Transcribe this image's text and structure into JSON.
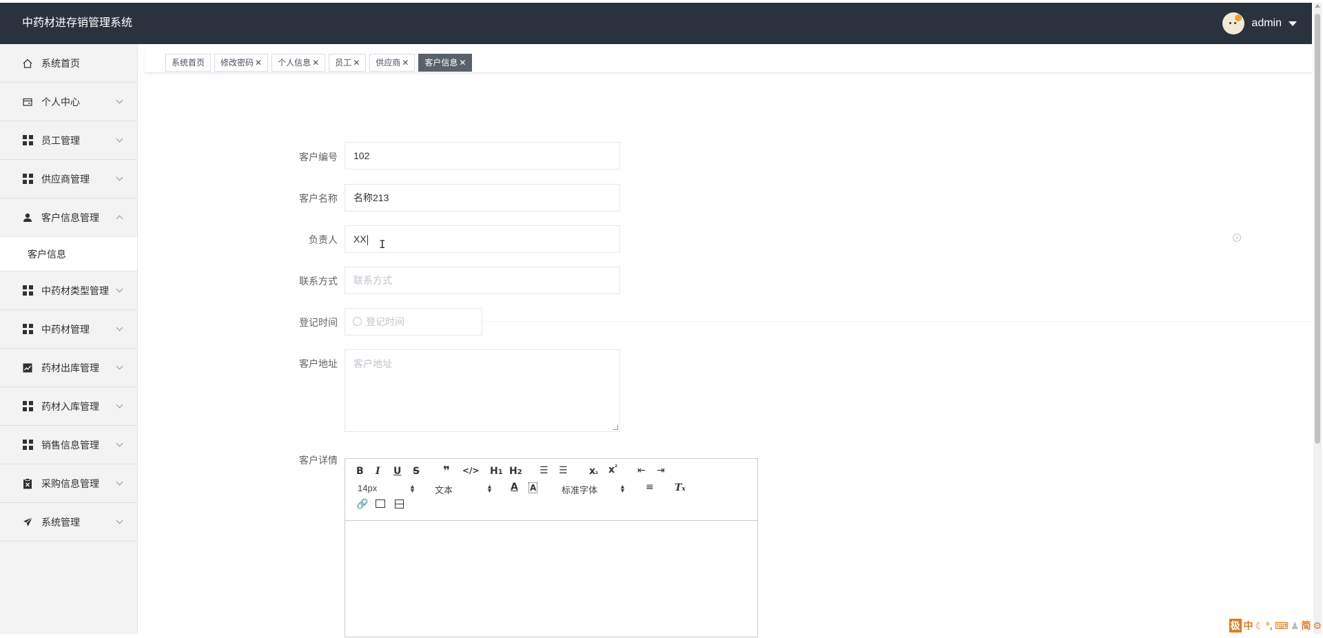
{
  "app": {
    "title": "中药材进存销管理系统",
    "user": "admin"
  },
  "sidebar": {
    "items": [
      {
        "label": "系统首页",
        "icon": "home-icon"
      },
      {
        "label": "个人中心",
        "icon": "wallet-icon"
      },
      {
        "label": "员工管理",
        "icon": "grid-icon"
      },
      {
        "label": "供应商管理",
        "icon": "grid-icon"
      },
      {
        "label": "客户信息管理",
        "icon": "user-icon",
        "expanded": true
      },
      {
        "label": "中药材类型管理",
        "icon": "grid-icon"
      },
      {
        "label": "中药材管理",
        "icon": "grid-icon"
      },
      {
        "label": "药材出库管理",
        "icon": "chart-icon"
      },
      {
        "label": "药材入库管理",
        "icon": "grid-icon"
      },
      {
        "label": "销售信息管理",
        "icon": "grid-icon"
      },
      {
        "label": "采购信息管理",
        "icon": "clipboard-icon"
      },
      {
        "label": "系统管理",
        "icon": "paper-plane-icon"
      }
    ],
    "sub_item": "客户信息"
  },
  "tags": [
    {
      "label": "系统首页",
      "closable": false
    },
    {
      "label": "修改密码",
      "closable": true
    },
    {
      "label": "个人信息",
      "closable": true
    },
    {
      "label": "员工",
      "closable": true
    },
    {
      "label": "供应商",
      "closable": true
    },
    {
      "label": "客户信息",
      "closable": true,
      "active": true
    }
  ],
  "form": {
    "code": {
      "label": "客户编号",
      "value": "102"
    },
    "name": {
      "label": "客户名称",
      "value": "名称213"
    },
    "manager": {
      "label": "负责人",
      "value": "XX"
    },
    "contact": {
      "label": "联系方式",
      "placeholder": "联系方式"
    },
    "date": {
      "label": "登记时间",
      "placeholder": "登记时间"
    },
    "address": {
      "label": "客户地址",
      "placeholder": "客户地址"
    },
    "detail": {
      "label": "客户详情"
    }
  },
  "editor": {
    "font_size": "14px",
    "block_type": "文本",
    "font_family": "标准字体"
  },
  "ime": [
    "极",
    "中",
    "简"
  ]
}
